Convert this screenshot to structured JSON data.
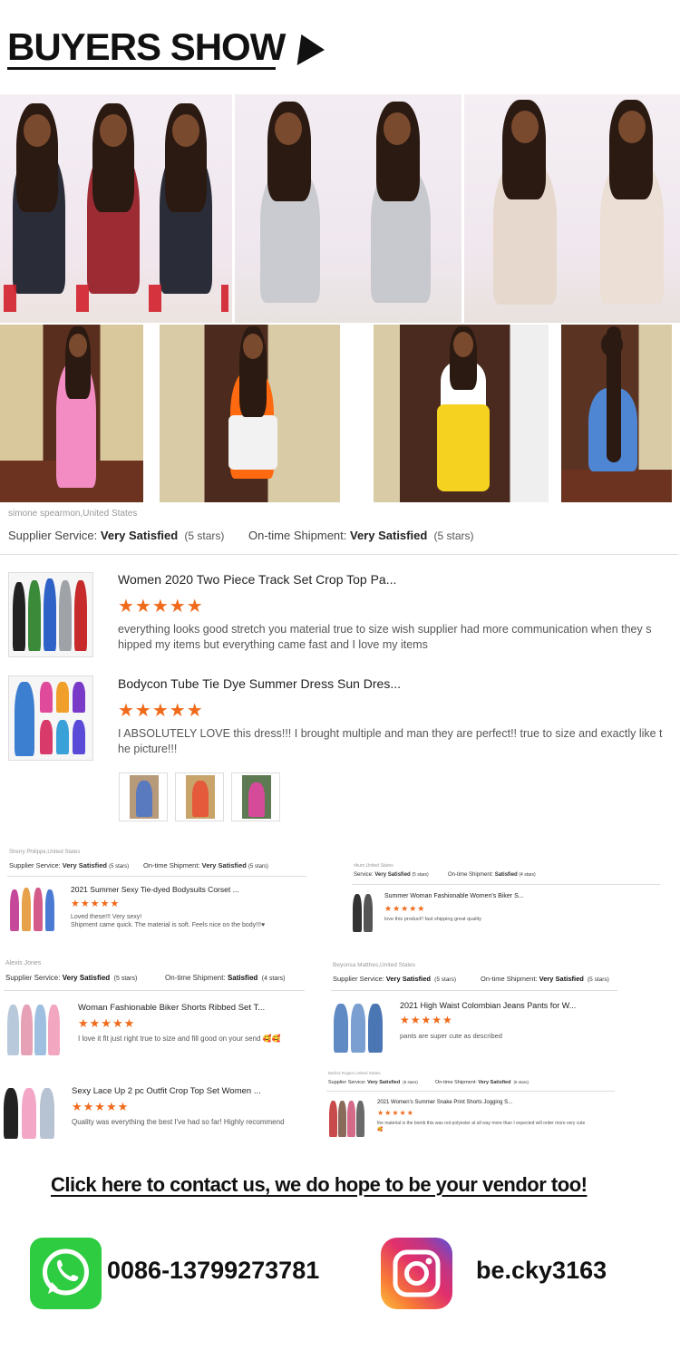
{
  "header": {
    "title": "BUYERS SHOW"
  },
  "main_review": {
    "reviewer": "simone spearmon,United States",
    "supplier_label": "Supplier Service:",
    "supplier_value": "Very Satisfied",
    "supplier_stars": "(5 stars)",
    "shipment_label": "On-time Shipment:",
    "shipment_value": "Very Satisfied",
    "shipment_stars": "(5 stars)",
    "items": [
      {
        "title": "Women 2020 Two Piece Track Set Crop Top Pa...",
        "stars": "★★★★★",
        "review_line1": "everything looks good stretch you material true to size wish supplier had more communication when they s",
        "review_line2": "hipped my items but everything came fast and I love my items"
      },
      {
        "title": "Bodycon Tube Tie Dye Summer Dress Sun Dres...",
        "stars": "★★★★★",
        "review_line1": "I ABSOLUTELY LOVE this dress!!! I brought multiple and man they are perfect!! true to size and exactly like t",
        "review_line2": "he picture!!!"
      }
    ]
  },
  "reviews": {
    "r1": {
      "reviewer": "Sherry Philippe,United States",
      "supplier_label": "Supplier Service:",
      "supplier_value": "Very Satisfied",
      "supplier_stars": "(5 stars)",
      "shipment_label": "On-time Shipment:",
      "shipment_value": "Very Satisfied",
      "shipment_stars": "(5 stars)",
      "title": "2021 Summer Sexy Tie-dyed Bodysuits Corset ...",
      "stars": "★★★★★",
      "review_line1": "Loved these!!! Very sexy!",
      "review_line2": "Shipment came quick. The material is soft. Feels nice on the body!!!♥"
    },
    "r2": {
      "reviewer": "rikum,United States",
      "supplier_label": "Service:",
      "supplier_value": "Very Satisfied",
      "supplier_stars": "(5 stars)",
      "shipment_label": "On-time Shipment:",
      "shipment_value": "Satisfied",
      "shipment_stars": "(4 stars)",
      "title": "Summer Woman Fashionable Women's Biker S...",
      "stars": "★★★★★",
      "review_line1": "love this product!! fast shipping great quality"
    },
    "r3": {
      "reviewer": "Alexis Jones",
      "supplier_label": "Supplier Service:",
      "supplier_value": "Very Satisfied",
      "supplier_stars": "(5 stars)",
      "shipment_label": "On-time Shipment:",
      "shipment_value": "Satisfied",
      "shipment_stars": "(4 stars)",
      "title": "Woman Fashionable Biker Shorts Ribbed Set T...",
      "stars": "★★★★★",
      "review_line1": "I love it fit just right true to size and fill good on your send 🥰🥰"
    },
    "r4": {
      "reviewer": "Beyonsa Matthes,United States",
      "supplier_label": "Supplier Service:",
      "supplier_value": "Very Satisfied",
      "supplier_stars": "(5 stars)",
      "shipment_label": "On-time Shipment:",
      "shipment_value": "Very Satisfied",
      "shipment_stars": "(5 stars)",
      "title": "2021 High Waist Colombian Jeans Pants for W...",
      "stars": "★★★★★",
      "review_line1": "pants are super cute as described"
    },
    "r5": {
      "title": "Sexy Lace Up 2 pc Outfit Crop Top Set Women ...",
      "stars": "★★★★★",
      "review_line1": "Quality was everything the best I've had so far! Highly recommend"
    },
    "r6": {
      "reviewer": "Barbra Rogers,United States",
      "supplier_label": "Supplier Service:",
      "supplier_value": "Very Satisfied",
      "supplier_stars": "(5 stars)",
      "shipment_label": "On-time Shipment:",
      "shipment_value": "Very Satisfied",
      "shipment_stars": "(5 stars)",
      "title": "2021 Women's Summer Snake Print Shorts Jogging S...",
      "stars": "★★★★★",
      "review_line1": "the material is the bomb this was not polyester at all way more than I expected will order more very cute",
      "review_line2": "🥰"
    }
  },
  "cta": {
    "text": "Click here to contact us, we do hope to be your vendor too!"
  },
  "contacts": {
    "whatsapp_icon": "whatsapp-icon",
    "whatsapp_number": "0086-13799273781",
    "instagram_icon": "instagram-icon",
    "instagram_handle": "be.cky3163"
  },
  "colors": {
    "star": "#f06a1a",
    "whatsapp": "#2ecc40"
  }
}
